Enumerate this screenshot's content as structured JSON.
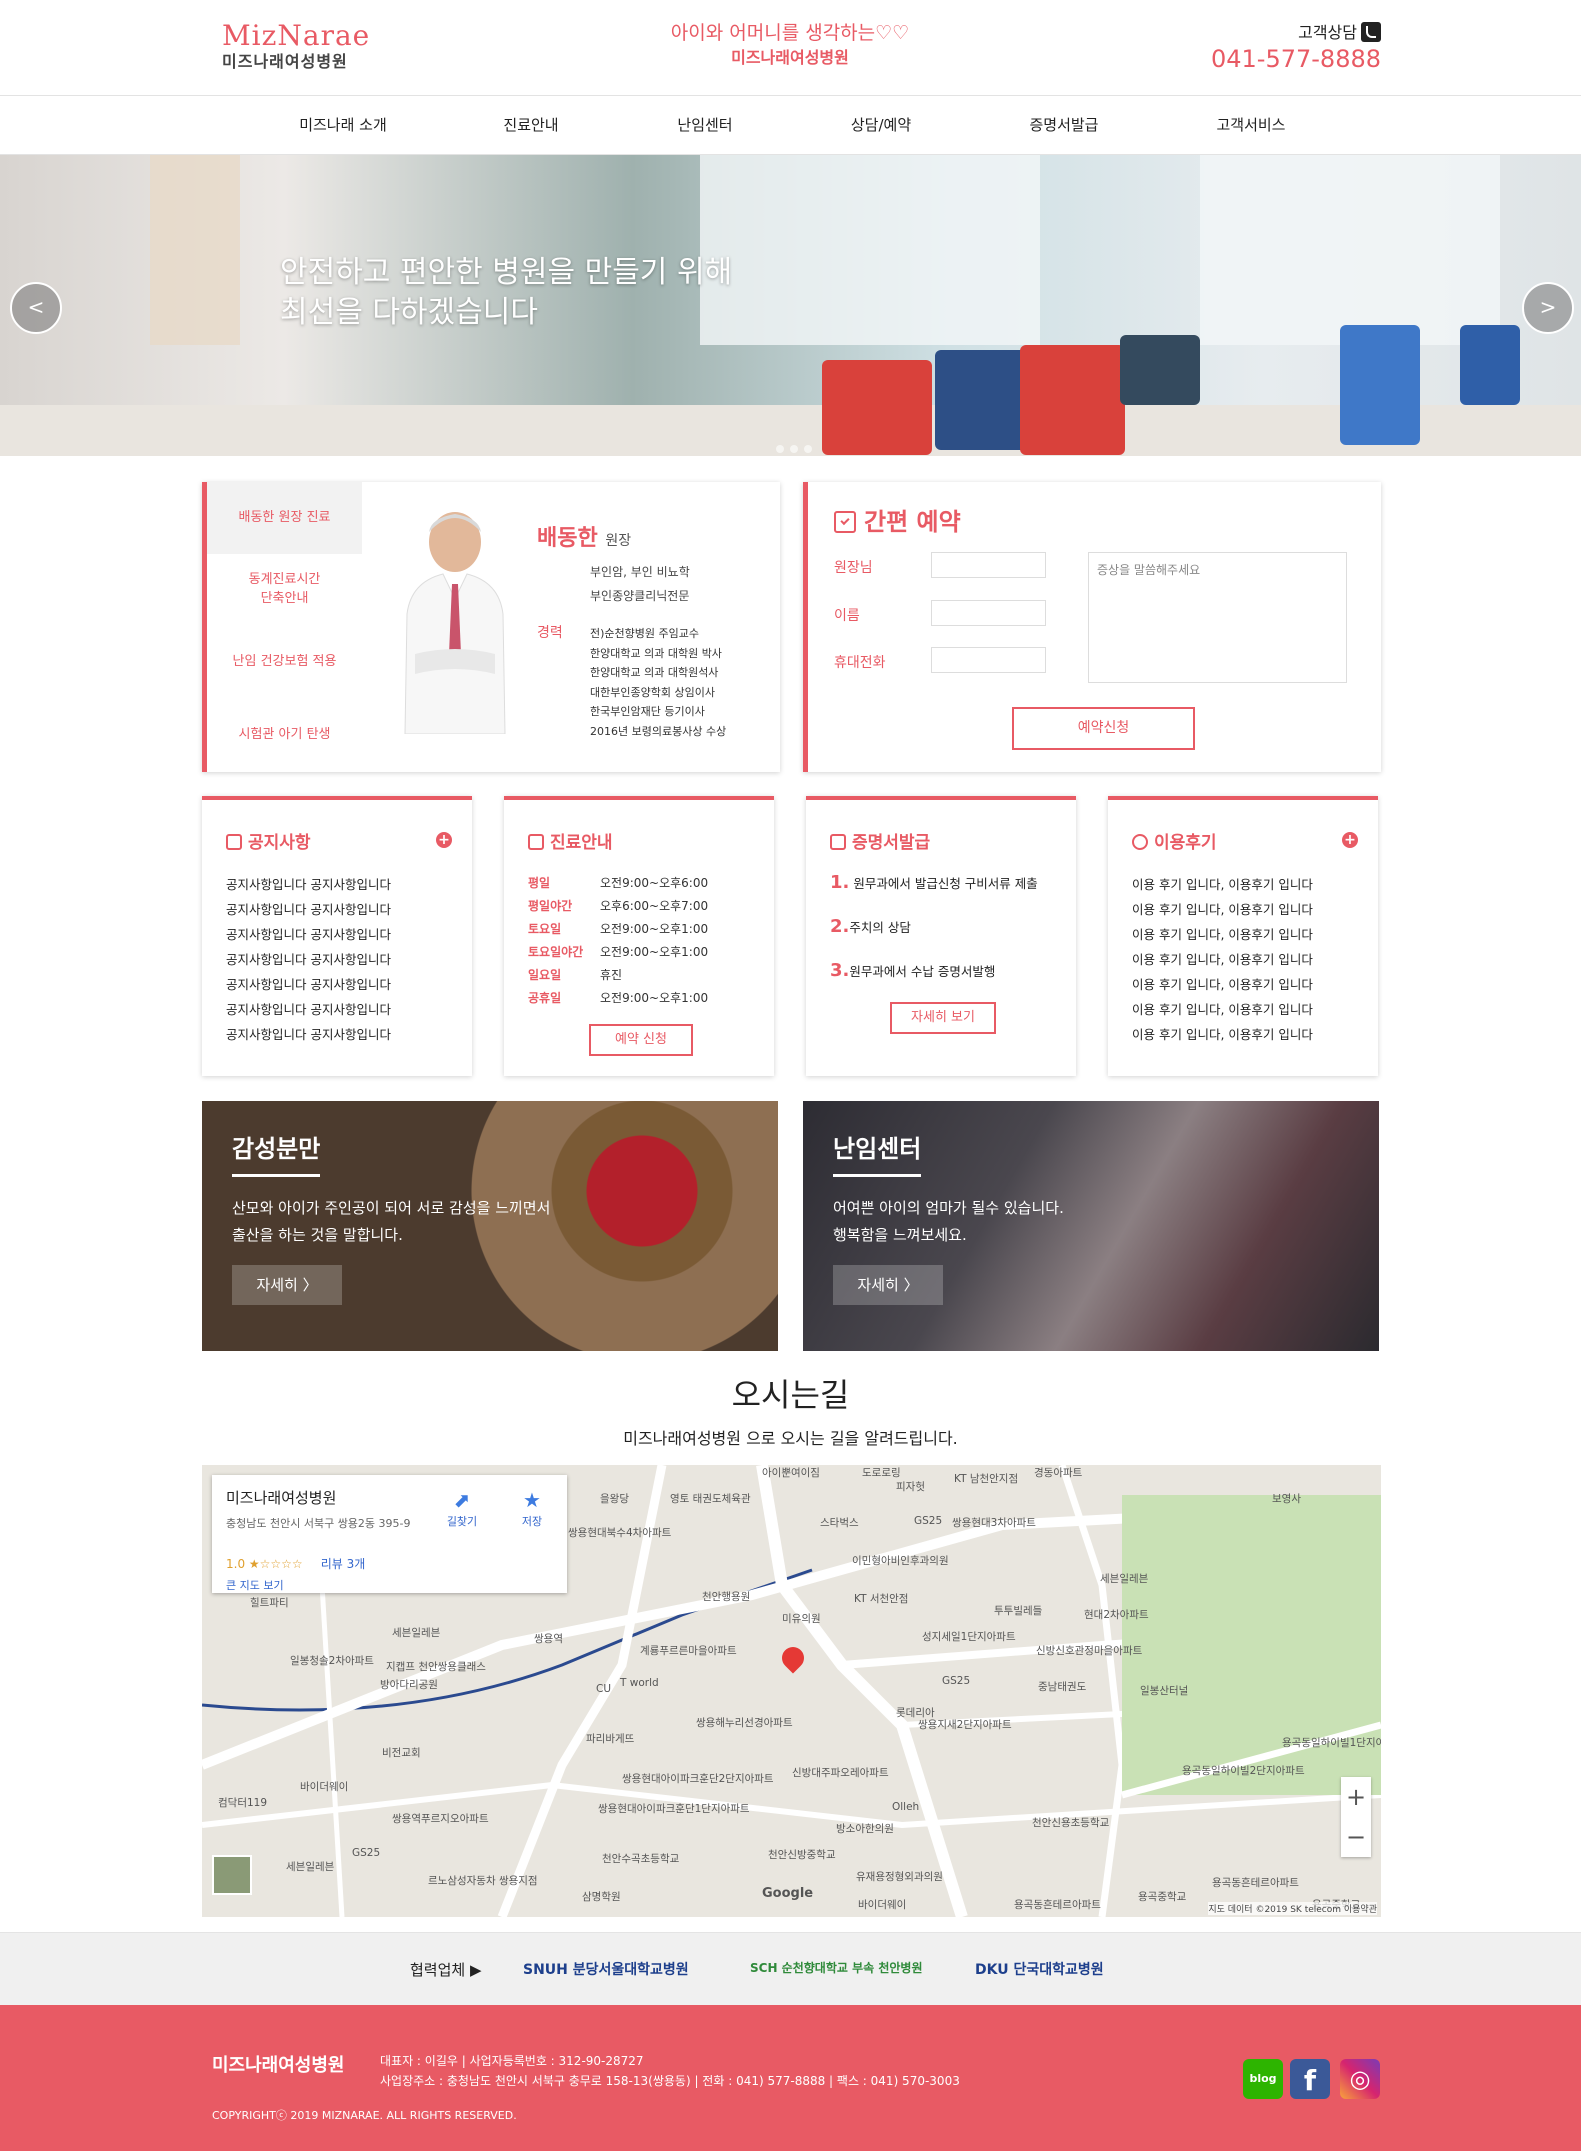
{
  "header": {
    "logo_en": "MizNarae",
    "logo_ko": "미즈나래여성병원",
    "slogan_line1": "아이와 어머니를 생각하는♡♡",
    "slogan_line2": "미즈나래여성병원",
    "cs_label": "고객상담",
    "cs_phone": "041-577-8888"
  },
  "nav": [
    "미즈나래 소개",
    "진료안내",
    "난임센터",
    "상담/예약",
    "증명서발급",
    "고객서비스"
  ],
  "hero": {
    "title_line1": "안전하고 편안한 병원을 만들기 위해",
    "title_line2": "최선을 다하겠습니다",
    "prev": "<",
    "next": ">"
  },
  "doctor": {
    "tabs": [
      "배동한 원장 진료",
      "동계진료시간\n단축안내",
      "난임 건강보험 적용",
      "시험관 아기 탄생"
    ],
    "name": "배동한",
    "role": "원장",
    "specialty": [
      "부인암, 부인 비뇨학",
      "부인종양클리닉전문"
    ],
    "career_label": "경력",
    "career": [
      "전)순천향병원 주임교수",
      "한양대학교 의과 대학원 박사",
      "한양대학교 의과 대학원석사",
      "대한부인종양학회 상임이사",
      "한국부인암재단 등기이사",
      "2016년 보령의료봉사상 수상"
    ]
  },
  "reservation": {
    "title": "간편 예약",
    "label_doctor": "원장님",
    "label_name": "이름",
    "label_phone": "휴대전화",
    "symptom_placeholder": "증상을 말씀해주세요",
    "submit": "예약신청"
  },
  "notice": {
    "title": "공지사항",
    "items": [
      "공지사항입니다 공지사항입니다",
      "공지사항입니다 공지사항입니다",
      "공지사항입니다 공지사항입니다",
      "공지사항입니다 공지사항입니다",
      "공지사항입니다 공지사항입니다",
      "공지사항입니다 공지사항입니다",
      "공지사항입니다 공지사항입니다"
    ]
  },
  "hours": {
    "title": "진료안내",
    "rows": [
      {
        "day": "평일",
        "time": "오전9:00~오후6:00"
      },
      {
        "day": "평일야간",
        "time": "오후6:00~오후7:00"
      },
      {
        "day": "토요일",
        "time": "오전9:00~오후1:00"
      },
      {
        "day": "토요일야간",
        "time": "오전9:00~오후1:00"
      },
      {
        "day": "일요일",
        "time": "휴진"
      },
      {
        "day": "공휴일",
        "time": "오전9:00~오후1:00"
      }
    ],
    "button": "예약 신청"
  },
  "certificate": {
    "title": "증명서발급",
    "steps": [
      {
        "num": "1.",
        "text": "원무과에서 발급신청 구비서류 제출"
      },
      {
        "num": "2.",
        "text": "주치의 상담"
      },
      {
        "num": "3.",
        "text": "원무과에서 수납 증명서발행"
      }
    ],
    "button": "자세히 보기"
  },
  "reviews": {
    "title": "이용후기",
    "items": [
      "이용 후기 입니다, 이용후기 입니다",
      "이용 후기 입니다, 이용후기 입니다",
      "이용 후기 입니다, 이용후기 입니다",
      "이용 후기 입니다, 이용후기 입니다",
      "이용 후기 입니다, 이용후기 입니다",
      "이용 후기 입니다, 이용후기 입니다",
      "이용 후기 입니다, 이용후기 입니다"
    ]
  },
  "promo": [
    {
      "title": "감성분만",
      "desc1": "산모와 아이가 주인공이 되어 서로 감성을 느끼면서",
      "desc2": "출산을 하는 것을 말합니다.",
      "button": "자세히 〉"
    },
    {
      "title": "난임센터",
      "desc1": "어여쁜 아이의 엄마가 될수 있습니다.",
      "desc2": "행복함을 느껴보세요.",
      "button": "자세히 〉"
    }
  ],
  "directions": {
    "title": "오시는길",
    "subtitle": "미즈나래여성병원 으로 오시는 길을 알려드립니다."
  },
  "map": {
    "place": "미즈나래여성병원",
    "address": "충청남도 천안시 서북구 쌍용2동 395-9",
    "rating": "1.0 ★☆☆☆☆",
    "reviews": "리뷰 3개",
    "bigmap": "큰 지도 보기",
    "directions": "길찾기",
    "save": "저장",
    "zoom_in": "+",
    "zoom_out": "−",
    "google": "Google",
    "attribution": "지도 데이터 ©2019 SK telecom   이용약관",
    "labels": [
      "아이뿐여이짐",
      "도로로링",
      "KT 남천안지점",
      "경동아파트",
      "을왕당",
      "영토 태권도체육관",
      "피자헛",
      "스타벅스",
      "GS25",
      "쌍용현대3차아파트",
      "보영사",
      "쌍용현대북수4차아파트",
      "이민형아비인후과의원",
      "세븐일레븐",
      "천안행용원",
      "KT 서천안점",
      "투투빌레들",
      "현대2차아파트",
      "힐트파티",
      "미유의원",
      "성지세일1단지아파트",
      "신방신호관정마을아파트",
      "세븐일레븐",
      "쌍용역",
      "계룡푸르른마을아파트",
      "일봉청솔2차아파트",
      "지캡프 천안쌍용클래스",
      "T world",
      "GS25",
      "중남태권도",
      "일봉산터널",
      "방아다리공원",
      "CU",
      "쌍용해누리선경아파트",
      "롯데리아",
      "쌍용지새2단지아파트",
      "비전교회",
      "파리바게뜨",
      "용곡동일하이빌1단지아파트",
      "바이더웨이",
      "쌍용현대아이파크훈단2단지아파트",
      "신방대주파오레아파트",
      "용곡동일하이빌2단지아파트",
      "컴닥터119",
      "쌍용역푸르지오아파트",
      "쌍용현대아이파크훈단1단지아파트",
      "Olleh",
      "천안신용초등학교",
      "GS25",
      "방소아한의원",
      "세븐일레븐",
      "천안수곡초등학교",
      "천안신방중학교",
      "르노삼성자동차 쌍용지점",
      "유재용정형외과의원",
      "삼명학원",
      "바이더웨이",
      "용곡중학교",
      "용곡중학교",
      "용곡동흔테르아파트",
      "용곡동흔테르아파트"
    ]
  },
  "partners": {
    "label": "협력업체 ▶",
    "items": [
      "SNUH 분당서울대학교병원",
      "SCH 순천향대학교 부속 천안병원",
      "DKU 단국대학교병원"
    ]
  },
  "footer": {
    "name": "미즈나래여성병원",
    "info1": "대표자 : 이길우 | 사업자등록번호 : 312-90-28727",
    "info2": "사업장주소 : 충청남도 천안시 서북구 충무로 158-13(쌍용동) | 전화 : 041) 577-8888 | 팩스 : 041) 570-3003",
    "copyright": "COPYRIGHTⓒ 2019 MIZNARAE. ALL RIGHTS RESERVED.",
    "sns": [
      "blog",
      "f",
      "◎"
    ]
  },
  "colors": {
    "accent": "#e85a64",
    "footer_bg": "#e85a64"
  }
}
